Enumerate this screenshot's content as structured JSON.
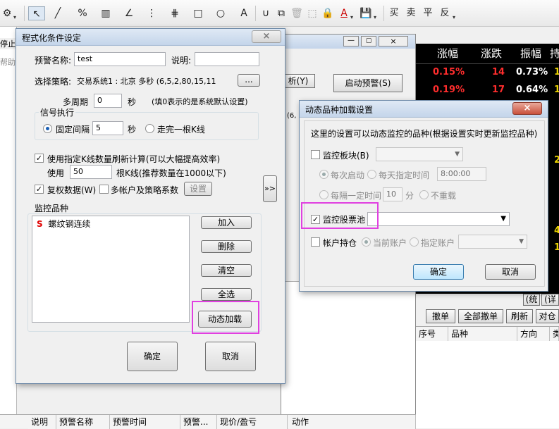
{
  "toolbar": {
    "items": [
      "⚙",
      "▾",
      "↖",
      "╱",
      "%",
      "▥",
      "∠",
      "⋮",
      "⋕",
      "□",
      "○",
      "A",
      "∪",
      "⧉",
      "🗑",
      "⬚",
      "🔒",
      "A",
      "▾",
      "💾",
      "▾"
    ],
    "actions": [
      "买",
      "卖",
      "平",
      "反"
    ]
  },
  "background": {
    "left_fragments": [
      "停止",
      "帮助("
    ],
    "btn_fragment": "析(Y)",
    "btn_start_alert": "启动预警(S)",
    "param_fragment": "(6,",
    "grid_headers": [
      "涨幅",
      "涨跌",
      "振幅",
      "持"
    ],
    "grid_rows": [
      {
        "pct": "0.15%",
        "chg": "14",
        "amp": "0.73%"
      },
      {
        "pct": "0.19%",
        "chg": "17",
        "amp": "0.64%"
      }
    ],
    "side_digits": [
      "1",
      "1",
      "2",
      "4",
      "1"
    ],
    "tabs": [
      "(统",
      "(详"
    ],
    "order_buttons": [
      "撤单",
      "全部撤单",
      "刷新",
      "对仓"
    ],
    "order_headers": [
      "序号",
      "品种",
      "方向",
      "类"
    ],
    "bottom_headers": [
      "说明",
      "预警名称",
      "预警时间",
      "预警...",
      "现价/盈亏",
      "动作"
    ]
  },
  "cond": {
    "title": "程式化条件设定",
    "close": "×",
    "alert_name_label": "预警名称:",
    "alert_name_value": "test",
    "desc_label": "说明:",
    "desc_value": "",
    "strategy_label": "选择策略:",
    "strategy_value": "交易系统1 : 北京 多秒 (6,5,2,80,15,11",
    "browse": "...",
    "multi_period_label": "多周期",
    "multi_period_value": "0",
    "sec_unit": "秒",
    "multi_period_hint": "(填0表示的是系统默认设置)",
    "signal_group": "信号执行",
    "fixed_interval": "固定间隔",
    "fixed_interval_value": "5",
    "sec_unit2": "秒",
    "walk_bar": "走完一根K线",
    "use_bars_label": "使用指定K线数量刷新计算(可以大幅提高效率)",
    "use_label": "使用",
    "use_value": "50",
    "bars_label": "根K线(推荐数量在1000以下)",
    "rights": "复权数据(W)",
    "multi_account": "多帐户及策略系数",
    "settings_btn": "设置",
    "expand_btn": "»>",
    "monitor_group": "监控品种",
    "monitor_items": [
      {
        "badge": "S",
        "name": "螺纹钢连续"
      }
    ],
    "btn_add": "加入",
    "btn_delete": "删除",
    "btn_clear": "清空",
    "btn_all": "全选",
    "btn_dynamic": "动态加载",
    "btn_ok": "确定",
    "btn_cancel": "取消"
  },
  "dyn": {
    "title": "动态品种加载设置",
    "close": "×",
    "desc": "这里的设置可以动态监控的品种(根据设置实时更新监控品种)",
    "monitor_sector": "监控板块(B)",
    "each_start": "每次启动",
    "daily_time": "每天指定时间",
    "time_value": "8:00:00",
    "interval": "每隔一定时间",
    "interval_value": "10",
    "minute_unit": "分",
    "no_reload": "不重载",
    "monitor_pool": "监控股票池",
    "account_holdings": "帐户持仓",
    "current_account": "当前账户",
    "specified_account": "指定账户",
    "ok": "确定",
    "cancel": "取消"
  },
  "colors": {
    "highlight": "#e040e0",
    "up_red": "#ff2d2d"
  }
}
